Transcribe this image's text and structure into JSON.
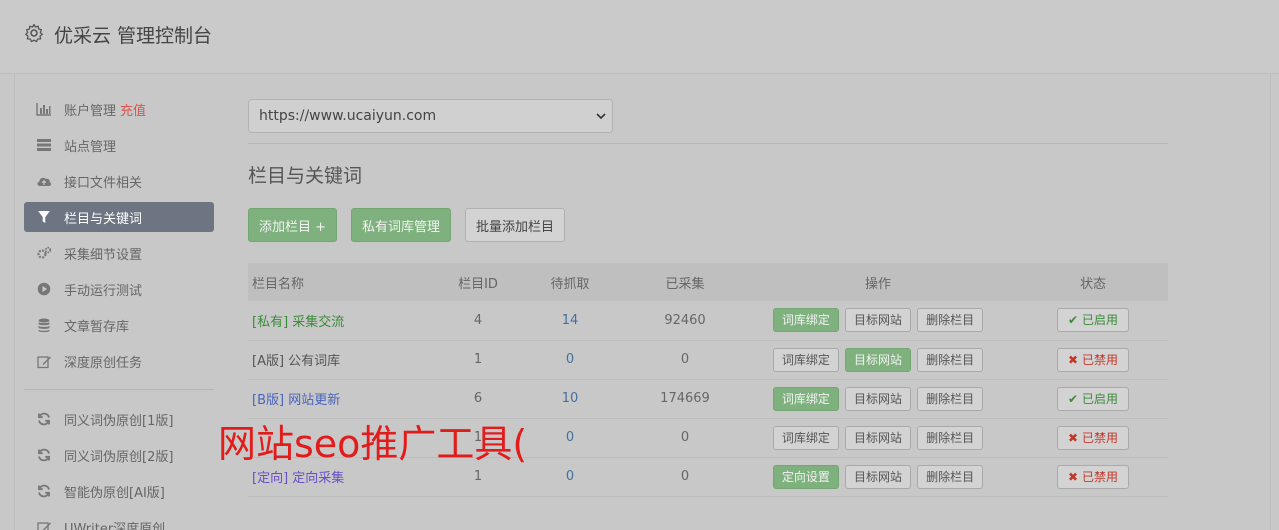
{
  "header": {
    "title": "优采云 管理控制台",
    "icon": "gear-icon"
  },
  "sidebar": {
    "items": [
      {
        "label": "账户管理",
        "extra": "充值",
        "icon": "bar-chart-icon"
      },
      {
        "label": "站点管理",
        "icon": "server-icon"
      },
      {
        "label": "接口文件相关",
        "icon": "cloud-upload-icon"
      },
      {
        "label": "栏目与关键词",
        "icon": "filter-icon",
        "active": true
      },
      {
        "label": "采集细节设置",
        "icon": "gears-icon"
      },
      {
        "label": "手动运行测试",
        "icon": "play-circle-icon"
      },
      {
        "label": "文章暂存库",
        "icon": "database-icon"
      },
      {
        "label": "深度原创任务",
        "icon": "edit-icon"
      }
    ],
    "items2": [
      {
        "label": "同义词伪原创[1版]",
        "icon": "refresh-icon"
      },
      {
        "label": "同义词伪原创[2版]",
        "icon": "refresh-icon"
      },
      {
        "label": "智能伪原创[AI版]",
        "icon": "refresh-icon"
      },
      {
        "label": "UWriter深度原创",
        "icon": "edit-icon"
      }
    ]
  },
  "main": {
    "site_select": "https://www.ucaiyun.com",
    "section_title": "栏目与关键词",
    "buttons": {
      "add_column": "添加栏目 +",
      "private_lib": "私有词库管理",
      "batch_add": "批量添加栏目"
    },
    "table": {
      "headers": {
        "name": "栏目名称",
        "id": "栏目ID",
        "pending": "待抓取",
        "collected": "已采集",
        "ops": "操作",
        "status": "状态"
      },
      "rows": [
        {
          "name": "[私有] 采集交流",
          "id": "4",
          "pending": "14",
          "collected": "92460",
          "op1": "词库绑定",
          "op2": "目标网站",
          "op3": "删除栏目",
          "status": "已启用",
          "status_icon": "check-icon"
        },
        {
          "name": "[A版] 公有词库",
          "id": "1",
          "pending": "0",
          "collected": "0",
          "op1": "词库绑定",
          "op2": "目标网站",
          "op3": "删除栏目",
          "status": "已禁用",
          "status_icon": "times-icon"
        },
        {
          "name": "[B版] 网站更新",
          "id": "6",
          "pending": "10",
          "collected": "174669",
          "op1": "词库绑定",
          "op2": "目标网站",
          "op3": "删除栏目",
          "status": "已启用",
          "status_icon": "check-icon"
        },
        {
          "name": "",
          "id": "1",
          "pending": "0",
          "collected": "0",
          "op1": "词库绑定",
          "op2": "目标网站",
          "op3": "删除栏目",
          "status": "已禁用",
          "status_icon": "times-icon"
        },
        {
          "name": "[定向] 定向采集",
          "id": "1",
          "pending": "0",
          "collected": "0",
          "op1": "定向设置",
          "op2": "目标网站",
          "op3": "删除栏目",
          "status": "已禁用",
          "status_icon": "times-icon"
        }
      ]
    }
  },
  "overlay_text": "网站seo推广工具(",
  "colors": {
    "accent_green": "#7fb17f",
    "active_nav": "#6d7583",
    "danger": "#c0392b",
    "overlay_red": "#e21b1b"
  }
}
